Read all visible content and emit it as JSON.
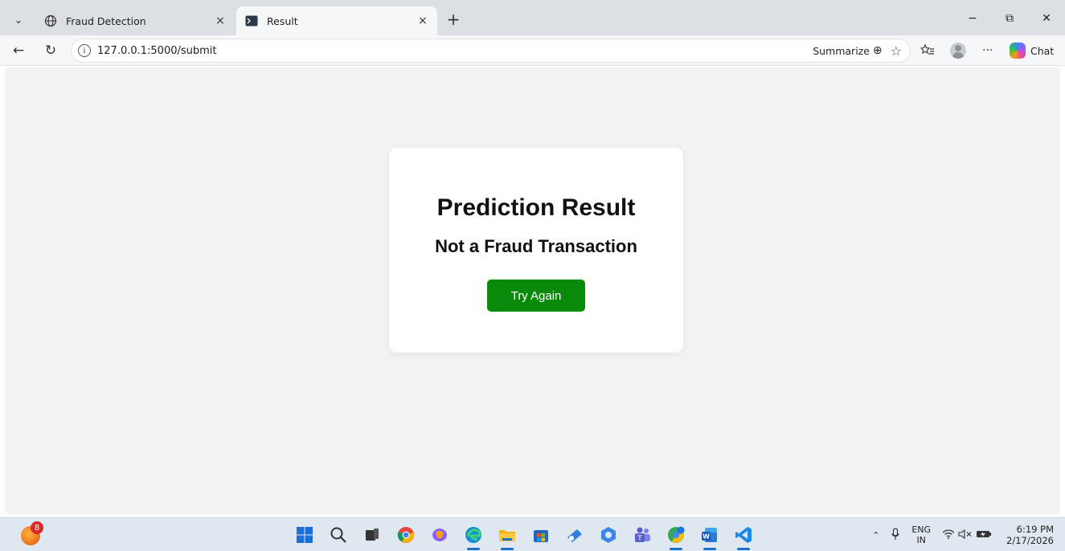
{
  "browser": {
    "tabs": [
      {
        "title": "Fraud Detection",
        "active": false,
        "close": "×"
      },
      {
        "title": "Result",
        "active": true,
        "close": "×"
      }
    ],
    "new_tab": "+",
    "window_controls": {
      "minimize": "−",
      "restore": "⧉",
      "close": "✕"
    },
    "address": "127.0.0.1:5000/submit",
    "info_glyph": "i",
    "summarize_label": "Summarize",
    "chat_label": "Chat",
    "more_glyph": "···"
  },
  "page": {
    "heading": "Prediction Result",
    "result": "Not a Fraud Transaction",
    "button_label": "Try Again",
    "button_color": "#0a8a0a"
  },
  "taskbar": {
    "widget_badge": "8",
    "tray": {
      "language_top": "ENG",
      "language_bottom": "IN",
      "time": "6:19 PM",
      "date": "2/17/2026"
    },
    "apps": [
      {
        "name": "start-icon",
        "color": "#1b6fd6"
      },
      {
        "name": "search-icon",
        "color": "#333333"
      },
      {
        "name": "task-view-icon",
        "color": "#333333"
      },
      {
        "name": "chrome-icon",
        "color": "#e8453c"
      },
      {
        "name": "copilot-icon",
        "color": "#8b5cf6"
      },
      {
        "name": "edge-icon",
        "color": "#0c8fd6"
      },
      {
        "name": "file-explorer-icon",
        "color": "#f4b400"
      },
      {
        "name": "store-icon",
        "color": "#2364c4"
      },
      {
        "name": "snipping-icon",
        "color": "#2f7ee0"
      },
      {
        "name": "photos-icon",
        "color": "#3a87e6"
      },
      {
        "name": "teams-icon",
        "color": "#5b5fc7"
      },
      {
        "name": "chrome-profile-icon",
        "color": "#1a73e8"
      },
      {
        "name": "word-icon",
        "color": "#2b579a"
      },
      {
        "name": "vscode-icon",
        "color": "#1e88e5"
      }
    ]
  }
}
